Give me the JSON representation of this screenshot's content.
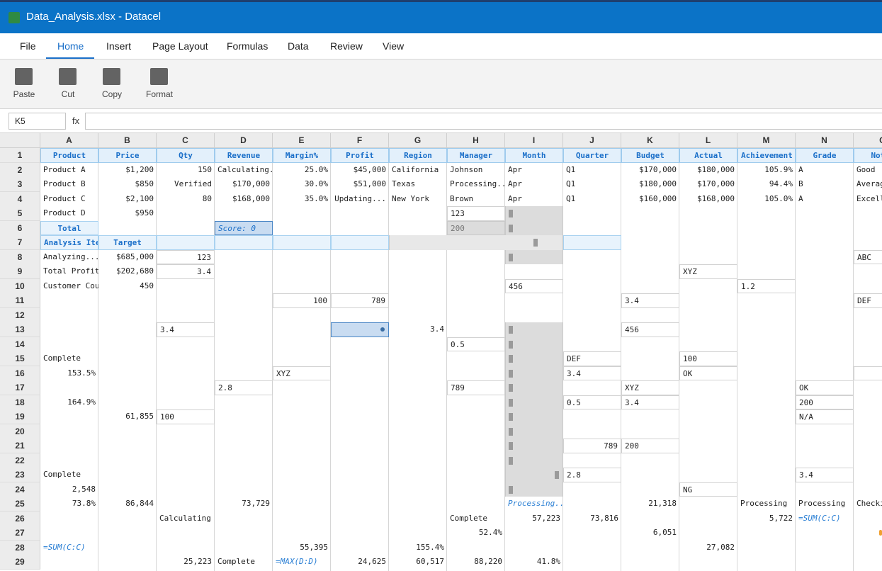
{
  "window": {
    "title": "Data_Analysis.xlsx - Datacel"
  },
  "menu": {
    "tabs": [
      "File",
      "Home",
      "Insert",
      "Page Layout",
      "Formulas",
      "Data",
      "Review",
      "View"
    ],
    "active": "Home"
  },
  "ribbon": {
    "buttons": [
      "Paste",
      "Cut",
      "Copy",
      "Format"
    ]
  },
  "formula_bar": {
    "cell_ref": "K5",
    "fx_label": "fx",
    "formula": ""
  },
  "columns": [
    "A",
    "B",
    "C",
    "D",
    "E",
    "F",
    "G",
    "H",
    "I",
    "J",
    "K",
    "L",
    "M",
    "N",
    "C"
  ],
  "rows": [
    "1",
    "2",
    "3",
    "4",
    "5",
    "6",
    "7",
    "8",
    "9",
    "10",
    "11",
    "12",
    "13",
    "14",
    "15",
    "16",
    "17",
    "18",
    "19",
    "20",
    "21",
    "22",
    "23",
    "24",
    "25",
    "26",
    "27",
    "28",
    "29"
  ],
  "header_row": [
    "Product",
    "Price",
    "Qty",
    "Revenue",
    "Margin%",
    "Profit",
    "Region",
    "Manager",
    "Month",
    "Quarter",
    "Budget",
    "Actual",
    "Achievement",
    "Grade",
    "Notes"
  ],
  "data_rows": [
    [
      "Product A",
      "$1,200",
      "150",
      "Calculating...",
      "25.0%",
      "$45,000",
      "California",
      "Johnson",
      "Apr",
      "Q1",
      "$170,000",
      "$180,000",
      "105.9%",
      "A",
      "Good"
    ],
    [
      "Product B",
      "$850",
      "Verified",
      "$170,000",
      "30.0%",
      "$51,000",
      "Texas",
      "Processing...",
      "Apr",
      "Q1",
      "$180,000",
      "$170,000",
      "94.4%",
      "B",
      "Average"
    ],
    [
      "Product C",
      "$2,100",
      "80",
      "$168,000",
      "35.0%",
      "Updating...",
      "New York",
      "Brown",
      "Apr",
      "Q1",
      "$160,000",
      "$168,000",
      "105.0%",
      "A",
      "Excellent"
    ]
  ],
  "cells": {
    "a5": "Product D",
    "b5": "$950",
    "h5": "123",
    "a6": "Total",
    "d6": "Score: 0",
    "h6": "200",
    "a7": "Analysis Item",
    "b7": "Target",
    "a8": "Analyzing...",
    "b8": "$685,000",
    "c8": "123",
    "o8": "ABC",
    "a9": "Total Profit",
    "b9": "$202,680",
    "c9": "3.4",
    "l9": "XYZ",
    "a10": "Customer Count",
    "b10": "450",
    "i10": "456",
    "m10": "1.2",
    "e11": "100",
    "f11": "789",
    "k11": "3.4",
    "o11": "DEF",
    "c13": "3.4",
    "g13": "3.4",
    "k13": "456",
    "h14": "0.5",
    "a15": "Complete",
    "j15": "DEF",
    "l15": "100",
    "a16": "153.5%",
    "e16": "XYZ",
    "j16": "3.4",
    "l16": "OK",
    "d17": "2.8",
    "h17": "789",
    "k17": "XYZ",
    "n17": "OK",
    "a18": "164.9%",
    "j18": "0.5",
    "k18": "3.4",
    "n18": "200",
    "b19": "61,855",
    "c19": "100",
    "n19": "N/A",
    "j21": "789",
    "k21": "200",
    "a23": "Complete",
    "j23": "2.8",
    "n23": "3.4",
    "a24": "2,548",
    "l24": "NG",
    "a25": "73.8%",
    "b25": "86,844",
    "d25": "73,729",
    "i25": "Processing...",
    "k25": "21,318",
    "m25": "Processing",
    "n25": "Processing",
    "o25": "Checking",
    "c26": "Calculating",
    "h26": "Complete",
    "i26": "57,223",
    "j26": "73,816",
    "m26": "5,722",
    "n26": "=SUM(C:C)",
    "h27": "52.4%",
    "k27": "6,051",
    "a28": "=SUM(C:C)",
    "e28": "55,395",
    "g28": "155.4%",
    "l28": "27,082",
    "c29": "25,223",
    "d29": "Complete",
    "e29": "=MAX(D:D)",
    "f29": "24,625",
    "g29": "60,517",
    "h29": "88,220",
    "i29": "41.8%"
  }
}
